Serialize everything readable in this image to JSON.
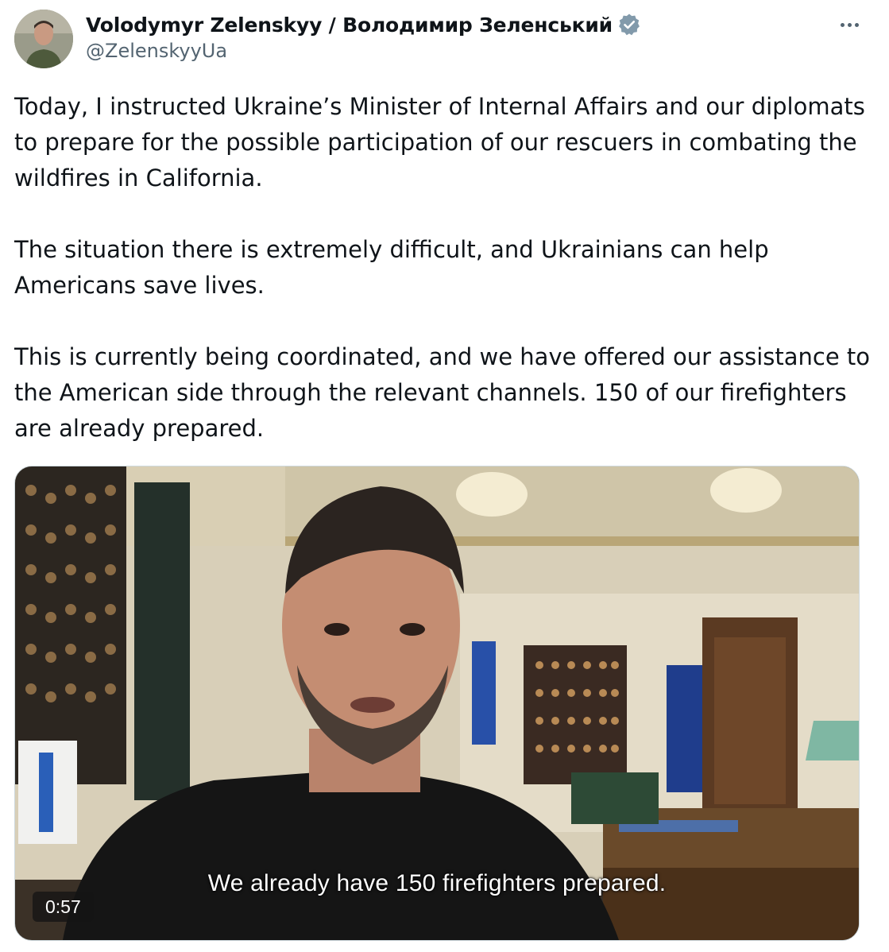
{
  "author": {
    "name": "Volodymyr Zelenskyy / Володимир Зеленський",
    "handle": "@ZelenskyyUa",
    "verified": true,
    "badge_color": "#829aab"
  },
  "tweet": {
    "paragraphs": [
      "Today, I instructed Ukraine’s Minister of Internal Affairs and our diplomats to prepare for the possible participation of our rescuers in combating the wildfires in California.",
      "The situation there is extremely difficult, and Ukrainians can help Americans save lives.",
      "This is currently being coordinated, and we have offered our assistance to the American side through the relevant channels. 150 of our firefighters are already prepared."
    ]
  },
  "media": {
    "type": "video",
    "caption": "We already have 150 firefighters prepared.",
    "duration": "0:57"
  },
  "icons": {
    "more": "more-options-icon",
    "verified": "verified-badge-icon"
  }
}
